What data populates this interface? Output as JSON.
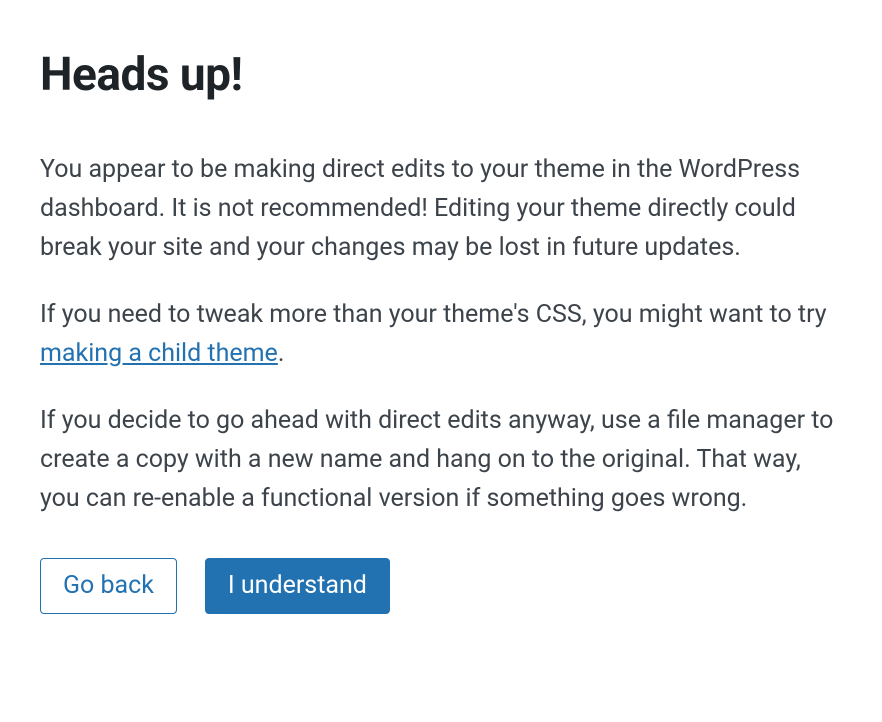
{
  "heading": "Heads up!",
  "para1": "You appear to be making direct edits to your theme in the WordPress dashboard. It is not recommended! Editing your theme directly could break your site and your changes may be lost in future updates.",
  "para2_before": "If you need to tweak more than your theme's CSS, you might want to try ",
  "para2_link": "making a child theme",
  "para2_after": ".",
  "para3": "If you decide to go ahead with direct edits anyway, use a file manager to create a copy with a new name and hang on to the original. That way, you can re-enable a functional version if something goes wrong.",
  "buttons": {
    "back": "Go back",
    "confirm": "I understand"
  }
}
